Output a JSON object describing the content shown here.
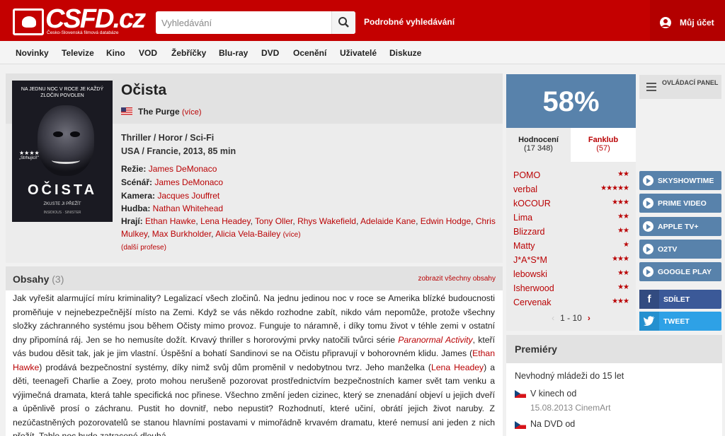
{
  "header": {
    "logo_text": "CSFD.cz",
    "logo_sub": "Česko-Slovenská filmová databáze",
    "search_placeholder": "Vyhledávání",
    "advanced_search": "Podrobné vyhledávání",
    "account": "Můj účet"
  },
  "nav": [
    "Novinky",
    "Televize",
    "Kino",
    "VOD",
    "Žebříčky",
    "Blu-ray",
    "DVD",
    "Ocenění",
    "Uživatelé",
    "Diskuze"
  ],
  "movie": {
    "title": "Očista",
    "original_title": "The Purge",
    "original_more": "(více)",
    "genre": "Thriller / Horor / Sci-Fi",
    "origin": "USA / Francie, 2013, 85 min",
    "crew": [
      {
        "label": "Režie:",
        "names": "James DeMonaco"
      },
      {
        "label": "Scénář:",
        "names": "James DeMonaco"
      },
      {
        "label": "Kamera:",
        "names": "Jacques Jouffret"
      },
      {
        "label": "Hudba:",
        "names": "Nathan Whitehead"
      }
    ],
    "actors_label": "Hrají:",
    "actors": [
      "Ethan Hawke",
      "Lena Headey",
      "Tony Oller",
      "Rhys Wakefield",
      "Adelaide Kane",
      "Edwin Hodge",
      "Chris Mulkey",
      "Max Burkholder",
      "Alicia Vela-Bailey"
    ],
    "actors_more": "(více)",
    "more_professions": "(další profese)",
    "poster": {
      "tagline": "NA JEDNU NOC V ROCE JE KAŽDÝ ZLOČIN POVOLEN",
      "stars": "★★★★",
      "quote": "„Strhující!\"",
      "title": "OČISTA",
      "subtitle": "ZKUSTE JI PŘEŽÍT",
      "credits": "INSIDIOUS · SINISTER"
    }
  },
  "plots": {
    "title": "Obsahy",
    "count": "(3)",
    "show_all": "zobrazit všechny obsahy",
    "text_1": "Jak vyřešit alarmující míru kriminality? Legalizací všech zločinů. Na jednu jedinou noc v roce se Amerika blízké budoucnosti proměňuje v nejnebezpečnější místo na Zemi. Když se vás někdo rozhodne zabít, nikdo vám nepomůže, protože všechny složky záchranného systému jsou během Očisty mimo provoz. Funguje to náramně, i díky tomu život v téhle zemi v ostatní dny připomíná ráj. Jen se ho nemusíte dožít. Krvavý thriller s hororovými prvky natočili tvůrci série ",
    "text_italic": "Paranormal Activity",
    "text_2": ", kteří vás budou děsit tak, jak je jim vlastní. Úspěšní a bohatí Sandinovi se na Očistu připravují v bohorovném klidu. James (",
    "link_1": "Ethan Hawke",
    "text_3": ") prodává bezpečnostní systémy, díky nimž svůj dům proměnil v nedobytnou tvrz. Jeho manželka (",
    "link_2": "Lena Headey",
    "text_4": ") a děti, teenageři Charlie a Zoey, proto mohou nerušeně pozorovat prostřednictvím bezpečnostních kamer svět tam venku a výjimečná dramata, která tahle specifická noc přinese. Všechno změní jeden cizinec, který se znenadání objeví u jejich dveří a úpěnlivě prosí o záchranu. Pustit ho dovnitř, nebo nepustit? Rozhodnutí, které učiní, obrátí jejich život naruby. Z nezúčastněných pozorovatelů se stanou hlavními postavami v mimořádně krvavém dramatu, které nemusí ani jeden z nich přežít. Tahle noc bude zatracené dlouhá."
  },
  "rating": {
    "percent": "58%",
    "tab_ratings": "Hodnocení",
    "tab_ratings_count": "(17 348)",
    "tab_fanclub": "Fanklub",
    "tab_fanclub_count": "(57)",
    "users": [
      {
        "name": "POMO",
        "stars": "★★"
      },
      {
        "name": "verbal",
        "stars": "★★★★★"
      },
      {
        "name": "kOCOUR",
        "stars": "★★★"
      },
      {
        "name": "Lima",
        "stars": "★★"
      },
      {
        "name": "Blizzard",
        "stars": "★★"
      },
      {
        "name": "Matty",
        "stars": "★"
      },
      {
        "name": "J*A*S*M",
        "stars": "★★★"
      },
      {
        "name": "lebowski",
        "stars": "★★"
      },
      {
        "name": "Isherwood",
        "stars": "★★"
      },
      {
        "name": "Cervenak",
        "stars": "★★★"
      }
    ],
    "pager": "1 - 10",
    "prev": "‹",
    "next": "›"
  },
  "premieres": {
    "title": "Premiéry",
    "age": "Nevhodný mládeži do 15 let",
    "items": [
      {
        "label": "V kinech od",
        "detail": "15.08.2013 CinemArt"
      },
      {
        "label": "Na DVD od",
        "detail": ""
      }
    ]
  },
  "side": {
    "panel": "OVLÁDACÍ PANEL",
    "services": [
      "SKYSHOWTIME",
      "PRIME VIDEO",
      "APPLE TV+",
      "O2TV",
      "GOOGLE PLAY"
    ],
    "share": "SDÍLET",
    "tweet": "TWEET",
    "colors": {
      "facebook": "#3b5998",
      "twitter": "#2ea1e6"
    }
  }
}
